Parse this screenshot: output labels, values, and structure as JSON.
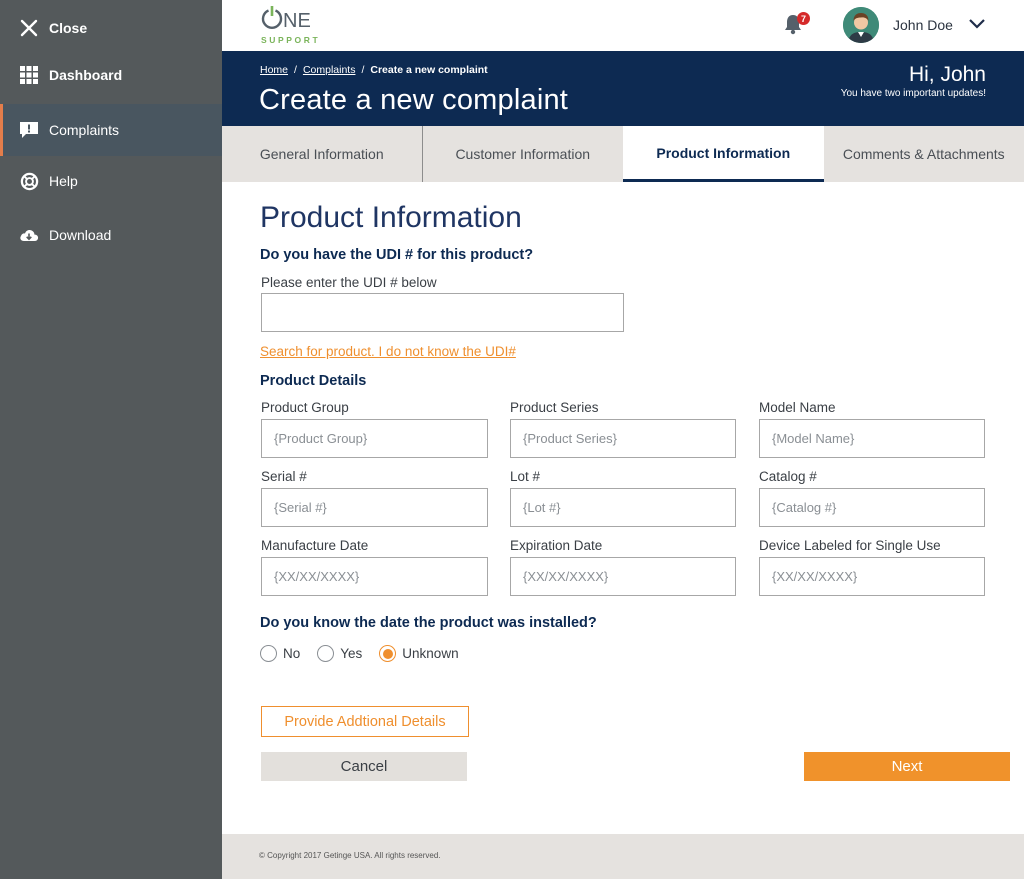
{
  "sidebar": {
    "items": [
      {
        "label": "Close",
        "icon": "close-icon"
      },
      {
        "label": "Dashboard",
        "icon": "grid-icon"
      },
      {
        "label": "Complaints",
        "icon": "comment-alert-icon"
      },
      {
        "label": "Help",
        "icon": "lifebuoy-icon"
      },
      {
        "label": "Download",
        "icon": "cloud-download-icon"
      }
    ]
  },
  "header": {
    "logo_main": "ONE",
    "logo_sub": "SUPPORT",
    "notification_count": "7",
    "user_name": "John Doe"
  },
  "banner": {
    "breadcrumbs": [
      "Home",
      "Complaints",
      "Create a new complaint"
    ],
    "title": "Create a new complaint",
    "greeting": "Hi, John",
    "updates": "You have two important updates!"
  },
  "tabs": [
    {
      "label": "General Information"
    },
    {
      "label": "Customer Information"
    },
    {
      "label": "Product Information",
      "active": true
    },
    {
      "label": "Comments & Attachments"
    }
  ],
  "form": {
    "section_title": "Product Information",
    "udi_question": "Do you have the UDI # for this product?",
    "udi_label": "Please enter the UDI # below",
    "udi_value": "",
    "search_link": "Search for product. I do not know the UDI#",
    "details_title": "Product Details",
    "fields": [
      {
        "label": "Product Group",
        "placeholder": "{Product Group}"
      },
      {
        "label": "Product Series",
        "placeholder": "{Product Series}"
      },
      {
        "label": "Model Name",
        "placeholder": "{Model Name}"
      },
      {
        "label": "Serial #",
        "placeholder": "{Serial #}"
      },
      {
        "label": "Lot #",
        "placeholder": "{Lot #}"
      },
      {
        "label": "Catalog #",
        "placeholder": "{Catalog #}"
      },
      {
        "label": "Manufacture Date",
        "placeholder": "{XX/XX/XXXX}"
      },
      {
        "label": "Expiration Date",
        "placeholder": "{XX/XX/XXXX}"
      },
      {
        "label": "Device Labeled for Single Use",
        "placeholder": "{XX/XX/XXXX}"
      }
    ],
    "install_question": "Do you know the date the product was installed?",
    "install_options": [
      "No",
      "Yes",
      "Unknown"
    ],
    "install_selected": "Unknown",
    "more_button": "Provide Addtional Details",
    "cancel_button": "Cancel",
    "next_button": "Next"
  },
  "footer": {
    "copyright": "© Copyright 2017 Getinge USA. All rights reserved."
  },
  "colors": {
    "sidebar": "#54595b",
    "banner": "#0d2a52",
    "accent": "#f0922b",
    "tab_bg": "#e5e2df"
  }
}
